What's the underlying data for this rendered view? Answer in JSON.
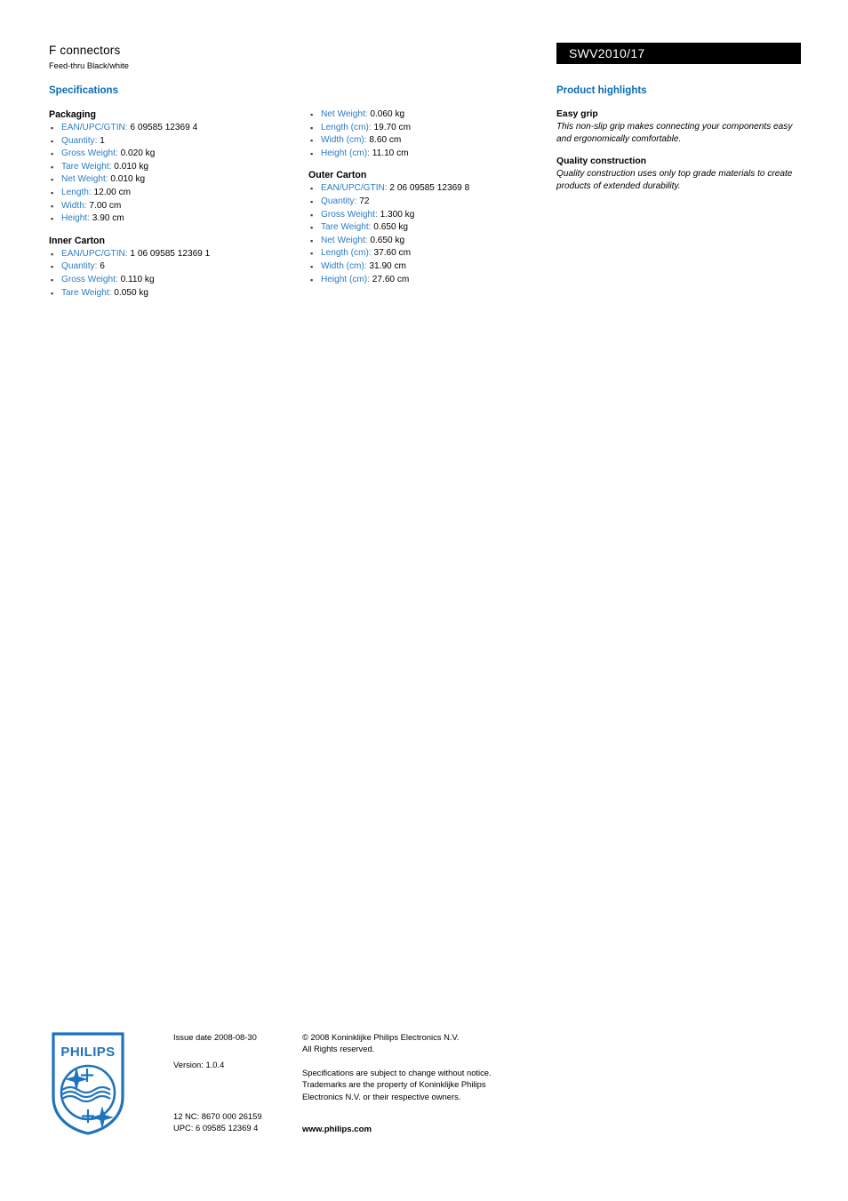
{
  "header": {
    "product_title": "F connectors",
    "product_subtitle": "Feed-thru Black/white",
    "model_number": "SWV2010/17"
  },
  "sections": {
    "specifications_heading": "Specifications",
    "highlights_heading": "Product highlights"
  },
  "spec_columns": [
    {
      "groups": [
        {
          "title": "Packaging",
          "items": [
            {
              "label": "EAN/UPC/GTIN:",
              "value": "6 09585 12369 4"
            },
            {
              "label": "Quantity:",
              "value": "1"
            },
            {
              "label": "Gross Weight:",
              "value": "0.020 kg"
            },
            {
              "label": "Tare Weight:",
              "value": "0.010 kg"
            },
            {
              "label": "Net Weight:",
              "value": "0.010 kg"
            },
            {
              "label": "Length:",
              "value": "12.00 cm"
            },
            {
              "label": "Width:",
              "value": "7.00 cm"
            },
            {
              "label": "Height:",
              "value": "3.90 cm"
            }
          ]
        },
        {
          "title": "Inner Carton",
          "items": [
            {
              "label": "EAN/UPC/GTIN:",
              "value": "1 06 09585 12369 1"
            },
            {
              "label": "Quantity:",
              "value": "6"
            },
            {
              "label": "Gross Weight:",
              "value": "0.110 kg"
            },
            {
              "label": "Tare Weight:",
              "value": "0.050 kg"
            }
          ]
        }
      ]
    },
    {
      "groups": [
        {
          "title": "",
          "items": [
            {
              "label": "Net Weight:",
              "value": "0.060 kg"
            },
            {
              "label": "Length (cm):",
              "value": "19.70 cm"
            },
            {
              "label": "Width (cm):",
              "value": "8.60 cm"
            },
            {
              "label": "Height (cm):",
              "value": "11.10 cm"
            }
          ]
        },
        {
          "title": "Outer Carton",
          "items": [
            {
              "label": "EAN/UPC/GTIN:",
              "value": "2 06 09585 12369 8"
            },
            {
              "label": "Quantity:",
              "value": "72"
            },
            {
              "label": "Gross Weight:",
              "value": "1.300 kg"
            },
            {
              "label": "Tare Weight:",
              "value": "0.650 kg"
            },
            {
              "label": "Net Weight:",
              "value": "0.650 kg"
            },
            {
              "label": "Length (cm):",
              "value": "37.60 cm"
            },
            {
              "label": "Width (cm):",
              "value": "31.90 cm"
            },
            {
              "label": "Height (cm):",
              "value": "27.60 cm"
            }
          ]
        }
      ]
    }
  ],
  "highlights": [
    {
      "title": "Easy grip",
      "description": "This non-slip grip makes connecting your components easy and ergonomically comfortable."
    },
    {
      "title": "Quality construction",
      "description": "Quality construction uses only top grade materials to create products of extended durability."
    }
  ],
  "footer": {
    "logo_wordmark": "PHILIPS",
    "issue_date": "Issue date 2008-08-30",
    "version": "Version: 1.0.4",
    "nc_code": "12 NC: 8670 000 26159",
    "upc": "UPC: 6 09585 12369 4",
    "copyright_line_1": "© 2008 Koninklijke Philips Electronics N.V.",
    "copyright_line_2": "All Rights reserved.",
    "disclaimer_line_1": "Specifications are subject to change without notice.",
    "disclaimer_line_2": "Trademarks are the property of Koninklijke Philips",
    "disclaimer_line_3": "Electronics N.V. or their respective owners.",
    "website": "www.philips.com"
  },
  "colors": {
    "heading_blue": "#0b6cb5",
    "label_blue": "#2b7cc4",
    "banner_black": "#000000",
    "logo_blue": "#1f73bd"
  },
  "bullet_glyph": "▪"
}
